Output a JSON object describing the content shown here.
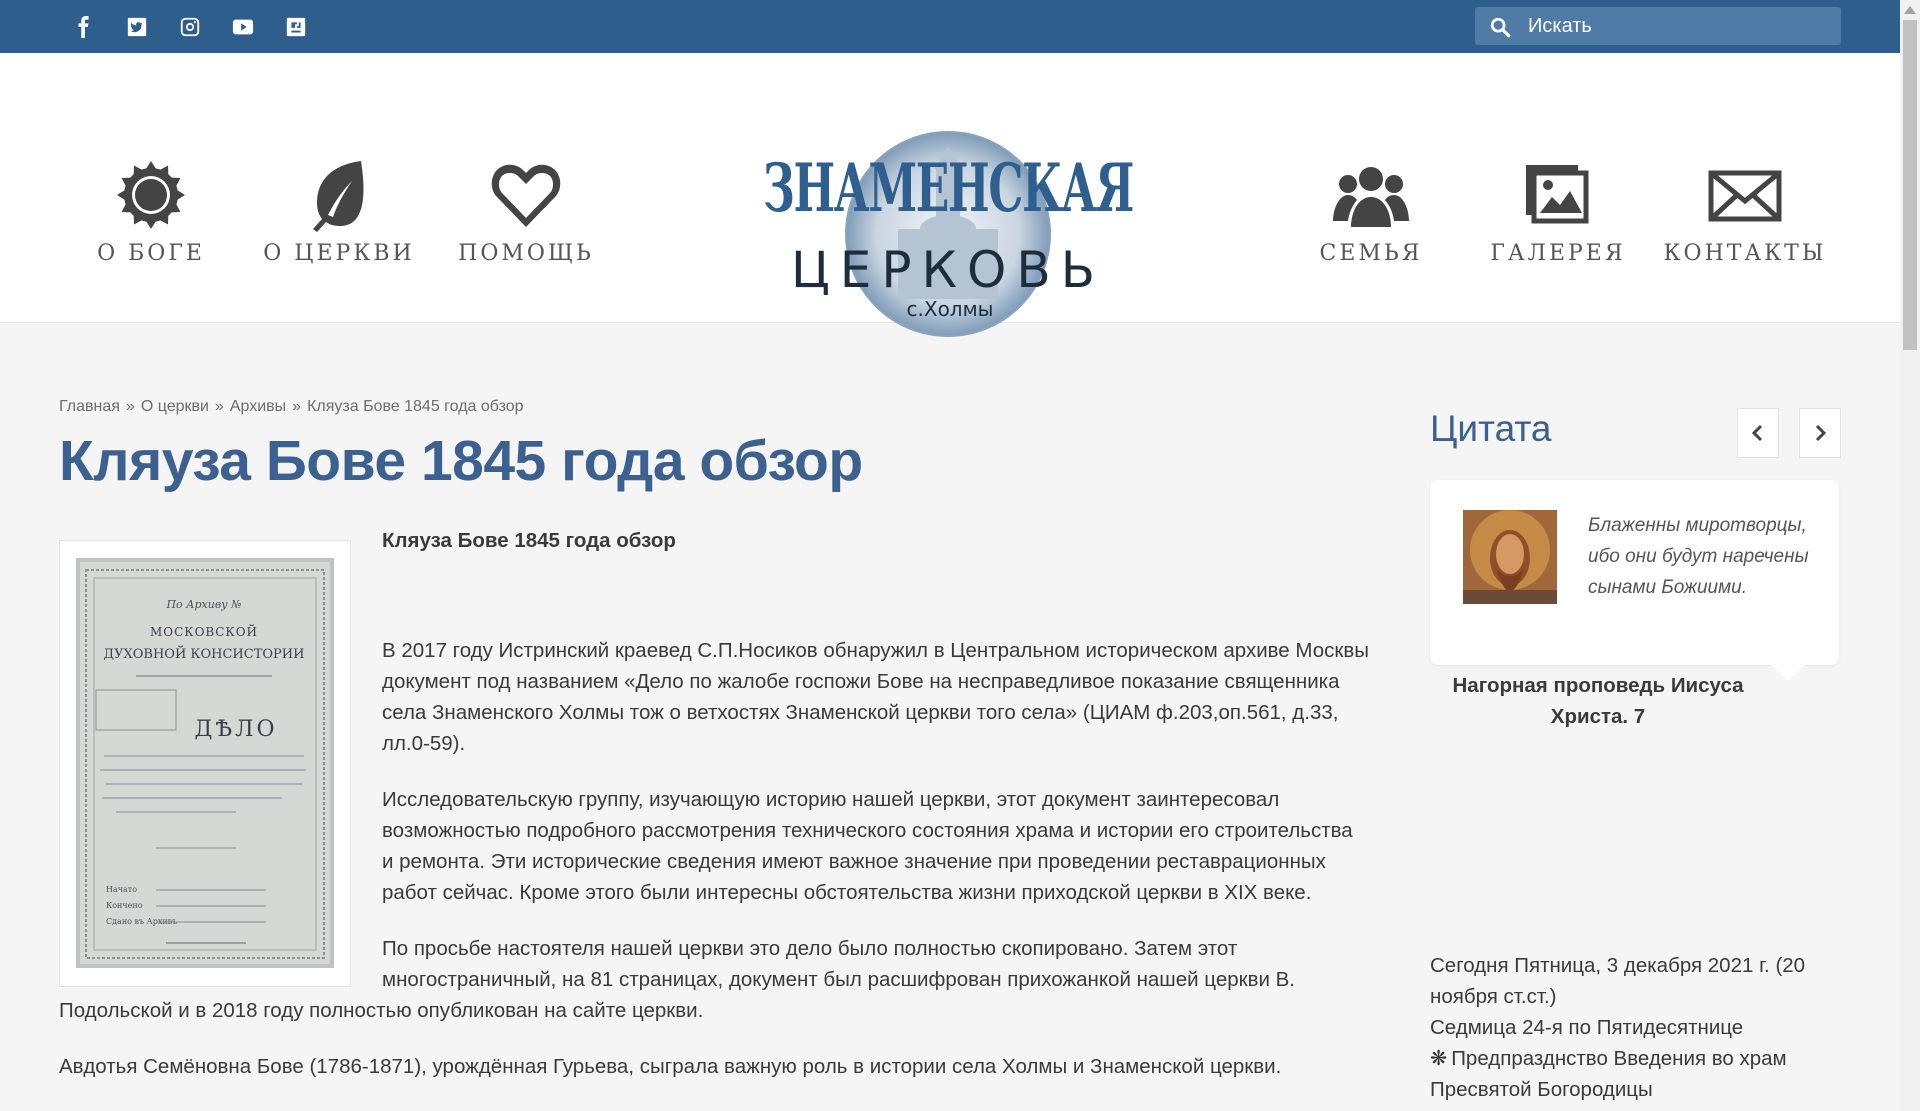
{
  "topbar": {
    "social": [
      "facebook-icon",
      "twitter-icon",
      "instagram-icon",
      "youtube-icon",
      "odnoklassniki-icon"
    ],
    "search_placeholder": "Искать"
  },
  "nav": {
    "left": [
      {
        "label": "О БОГЕ",
        "icon": "sun-icon"
      },
      {
        "label": "О ЦЕРКВИ",
        "icon": "leaf-icon"
      },
      {
        "label": "ПОМОЩЬ",
        "icon": "heart-icon"
      }
    ],
    "right": [
      {
        "label": "СЕМЬЯ",
        "icon": "family-icon"
      },
      {
        "label": "ГАЛЕРЕЯ",
        "icon": "gallery-icon"
      },
      {
        "label": "КОНТАКТЫ",
        "icon": "envelope-icon"
      }
    ]
  },
  "logo": {
    "line1": "ЗНАМЕНСКАЯ",
    "line2": "ЦЕРКОВЬ",
    "line3": "с.Холмы"
  },
  "breadcrumb": [
    "Главная",
    "О церкви",
    "Архивы",
    "Кляуза Бове 1845 года обзор"
  ],
  "breadcrumb_sep": "»",
  "article": {
    "title": "Кляуза Бове 1845 года обзор",
    "subheading": "Кляуза Бове 1845 года обзор",
    "paragraphs": [
      "В 2017 году Истринский краевед С.П.Носиков обнаружил в Центральном историческом архиве Москвы документ под названием «Дело по жалобе госпожи Бове на несправедливое показание священника села Знаменского Холмы тож о ветхостях Знаменской церкви того села» (ЦИАМ ф.203,оп.561, д.33, лл.0-59).",
      "Исследовательскую группу, изучающую историю нашей церкви, этот документ заинтересовал возможностью подробного рассмотрения технического состояния храма и истории его строительства и ремонта. Эти исторические сведения имеют важное значение при проведении реставрационных работ сейчас. Кроме этого были интересны обстоятельства жизни приходской церкви в XIX веке.",
      "По просьбе настоятеля нашей церкви это дело было полностью скопировано. Затем этот многостраничный, на 81 страницах, документ был расшифрован прихожанкой нашей церкви В. Подольской и в 2018 году полностью опубликован на сайте церкви.",
      "Авдотья Семёновна Бове (1786-1871), урождённая Гурьева, сыграла важную роль в истории села Холмы и Знаменской церкви."
    ],
    "document_image": {
      "archive_label": "По Архиву №",
      "line1": "МОСКОВСКОЙ",
      "line2": "ДУХОВНОЙ КОНСИСТОРИИ",
      "heading": "ДѢЛО",
      "started": "Начато",
      "finished": "Кончено",
      "archived": "Сдано въ Архивъ"
    }
  },
  "sidebar": {
    "title": "Цитата",
    "quote": "Блаженны миротворцы, ибо они будут наречены сынами Божиими.",
    "source": "Нагорная проповедь Иисуса Христа. 7",
    "today": {
      "date_line": "Сегодня Пятница, 3 декабря 2021 г. (20 ноября ст.ст.)",
      "week_line": "Седмица 24-я по Пятидесятнице",
      "star": "❋",
      "feast_line": "Предпразднство Введения во храм Пресвятой Богородицы"
    }
  },
  "colors": {
    "topbar": "#2d5e8c",
    "accent": "#3c6190",
    "search_bg": "#4f7ba6"
  }
}
